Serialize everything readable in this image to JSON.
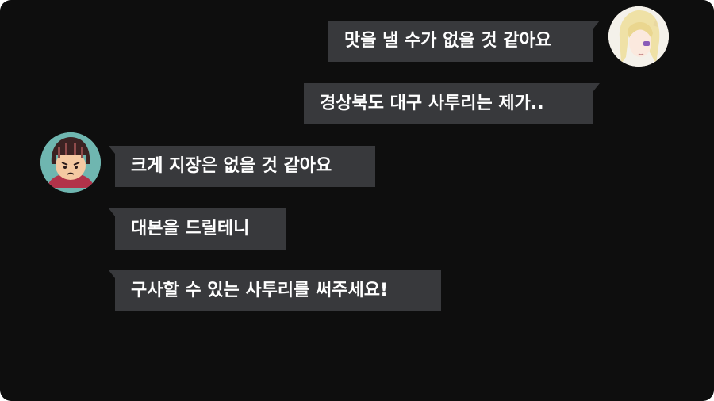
{
  "chat": {
    "messages": [
      {
        "sender": "blonde-girl",
        "side": "right",
        "text": "맛을 낼 수가 없을 것 같아요"
      },
      {
        "sender": "blonde-girl",
        "side": "right",
        "text": "경상북도 대구 사투리는 제가.."
      },
      {
        "sender": "dark-hair-person",
        "side": "left",
        "text": "크게 지장은 없을 것 같아요"
      },
      {
        "sender": "dark-hair-person",
        "side": "left",
        "text": "대본을 드릴테니"
      },
      {
        "sender": "dark-hair-person",
        "side": "left",
        "text": "구사할 수 있는 사투리를 써주세요!"
      }
    ]
  },
  "colors": {
    "background": "#0e0e0e",
    "bubble": "#38393c",
    "text": "#ffffff"
  }
}
